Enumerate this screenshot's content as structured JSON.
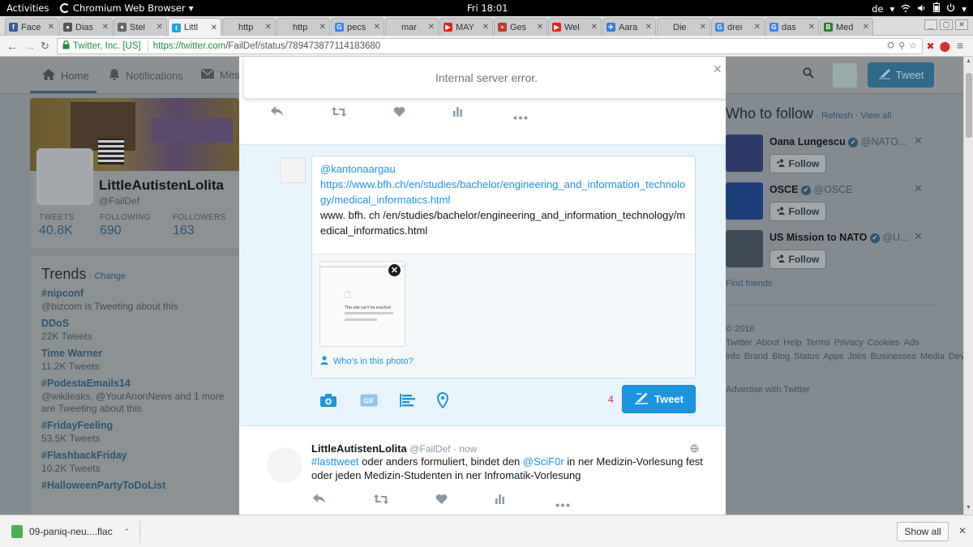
{
  "gnome": {
    "activities": "Activities",
    "app_name": "Chromium Web Browser",
    "clock": "Fri 18:01",
    "locale": "de"
  },
  "tabs": [
    {
      "label": "Face",
      "fav": "f",
      "color": "#3b5998"
    },
    {
      "label": "Dias",
      "fav": "●",
      "color": "#555"
    },
    {
      "label": "Stel",
      "fav": "●",
      "color": "#666"
    },
    {
      "label": "Littl",
      "fav": "t",
      "color": "#1da1f2"
    },
    {
      "label": "http",
      "fav": "",
      "color": "#ccc"
    },
    {
      "label": "http",
      "fav": "",
      "color": "#ccc"
    },
    {
      "label": "pecs",
      "fav": "G",
      "color": "#4285f4"
    },
    {
      "label": "mar",
      "fav": "",
      "color": "#ccc"
    },
    {
      "label": "MAY",
      "fav": "▶",
      "color": "#e62117"
    },
    {
      "label": "Ges",
      "fav": "+",
      "color": "#c0392b"
    },
    {
      "label": "Wel",
      "fav": "▶",
      "color": "#e62117"
    },
    {
      "label": "Aara",
      "fav": "✈",
      "color": "#3a7bd5"
    },
    {
      "label": "Die",
      "fav": "",
      "color": "#ccc"
    },
    {
      "label": "drei",
      "fav": "G",
      "color": "#4285f4"
    },
    {
      "label": "das",
      "fav": "G",
      "color": "#4285f4"
    },
    {
      "label": "Med",
      "fav": "B",
      "color": "#2e7d32"
    }
  ],
  "address": {
    "ev_label": "Twitter, Inc. [US]",
    "url_scheme_host": "https://twitter.com",
    "url_path": "/FailDef/status/789473877114183680"
  },
  "nav": {
    "home": "Home",
    "notifications": "Notifications",
    "messages": "Mes",
    "tweet": "Tweet"
  },
  "profile": {
    "name": "LittleAutistenLolita",
    "handle": "@FailDef",
    "stats": [
      {
        "label": "TWEETS",
        "value": "40.8K"
      },
      {
        "label": "FOLLOWING",
        "value": "690"
      },
      {
        "label": "FOLLOWERS",
        "value": "163"
      }
    ]
  },
  "trends": {
    "title": "Trends",
    "change": "Change",
    "items": [
      {
        "name": "#nipconf",
        "sub": "@bizcom is Tweeting about this"
      },
      {
        "name": "DDoS",
        "sub": "22K Tweets"
      },
      {
        "name": "Time Warner",
        "sub": "11.2K Tweets"
      },
      {
        "name": "#PodestaEmails14",
        "sub": "@wikileaks, @YourAnonNews and 1 more are Tweeting about this"
      },
      {
        "name": "#FridayFeeling",
        "sub": "53.5K Tweets"
      },
      {
        "name": "#FlashbackFriday",
        "sub": "10.2K Tweets"
      },
      {
        "name": "#HalloweenPartyToDoList",
        "sub": ""
      }
    ]
  },
  "who_to_follow": {
    "title": "Who to follow",
    "refresh": "Refresh",
    "view_all": "View all",
    "follow_label": "Follow",
    "users": [
      {
        "name": "Oana Lungescu",
        "handle": "@NATO...",
        "color": "#2d3a6a"
      },
      {
        "name": "OSCE",
        "handle": "@OSCE",
        "color": "#1d3f7a"
      },
      {
        "name": "US Mission to NATO",
        "handle": "@U...",
        "color": "#3d4a55"
      }
    ],
    "find_friends": "Find friends"
  },
  "footer": {
    "links": [
      "© 2016 Twitter",
      "About",
      "Help",
      "Terms",
      "Privacy",
      "Cookies",
      "Ads info",
      "Brand",
      "Blog",
      "Status",
      "Apps",
      "Jobs",
      "Businesses",
      "Media",
      "Developers"
    ],
    "advertise": "Advertise with Twitter"
  },
  "error": {
    "message": "Internal server error."
  },
  "composer": {
    "mention": "@kantonaargau",
    "link": "https://www.bfh.ch/en/studies/bachelor/engineering_and_information_technology/medical_informatics.html",
    "plain": "www. bfh. ch /en/studies/bachelor/engineering_and_information_technology/medical_informatics.html",
    "thumb_title": "This site can't be reached",
    "whos_in_photo": "Who's in this photo?",
    "char_count": "4",
    "tweet_label": "Tweet"
  },
  "below_tweet": {
    "name": "LittleAutistenLolita",
    "handle": "@FailDef · now",
    "hashtag": "#lasttweet",
    "text1": " oder anders formuliert, bindet den ",
    "mention": "@SciF0r",
    "text2": " in ner Medizin-Vorlesung fest oder jeden Medizin-Studenten in ner Infromatik-Vorlesung"
  },
  "download": {
    "filename": "09-paniq-neu....flac",
    "show_all": "Show all"
  },
  "icons": [
    "home-icon",
    "notifications-icon",
    "messages-icon",
    "search-icon",
    "reply-icon",
    "retweet-icon",
    "like-icon",
    "analytics-icon",
    "more-icon",
    "camera-icon",
    "gif-icon",
    "poll-icon",
    "location-icon",
    "close-icon",
    "globe-icon",
    "person-icon",
    "compose-icon"
  ]
}
